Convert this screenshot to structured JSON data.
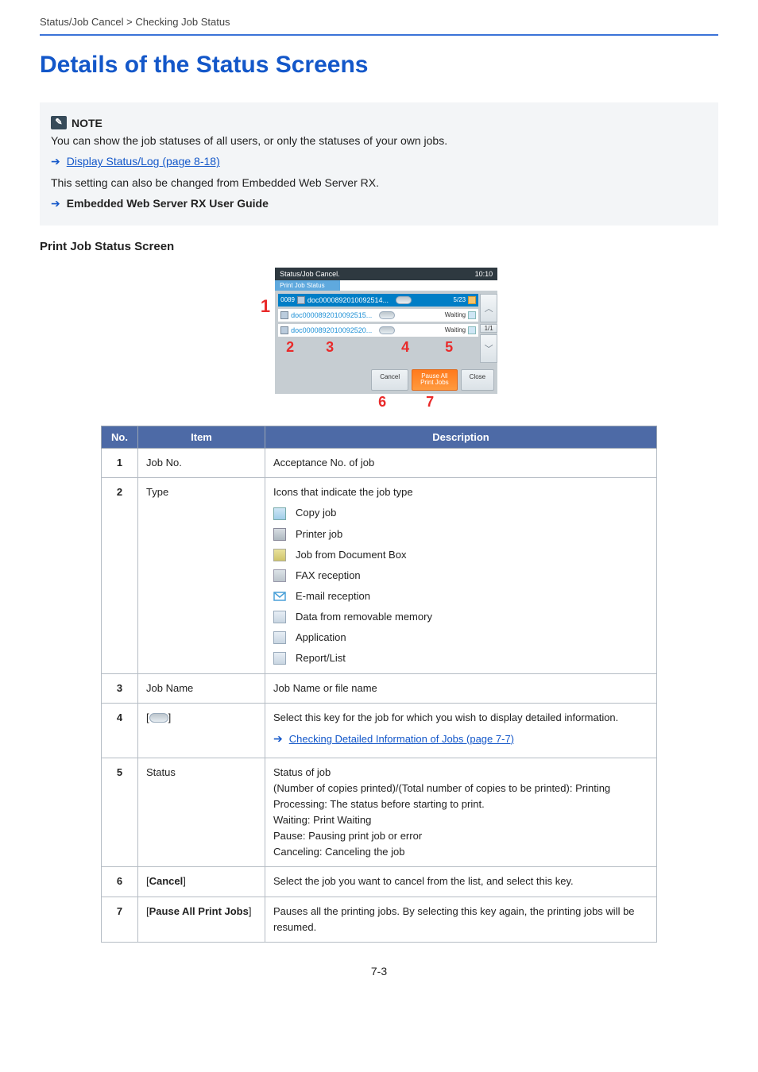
{
  "breadcrumb": "Status/Job Cancel > Checking Job Status",
  "page_title": "Details of the Status Screens",
  "note": {
    "label": "NOTE",
    "line1": "You can show the job statuses of all users, or only the statuses of your own jobs.",
    "link1": "Display Status/Log (page 8-18)",
    "line2": "This setting can also be changed from Embedded Web Server RX.",
    "link2": "Embedded Web Server RX User Guide"
  },
  "section_title": "Print Job Status Screen",
  "panel": {
    "titlebar_left": "Status/Job Cancel.",
    "titlebar_right": "10:10",
    "tab": "Print Job Status",
    "rows": [
      {
        "id": "0089",
        "name": "doc0000892010092514...",
        "status": "5/23"
      },
      {
        "id": "",
        "name": "doc0000892010092515...",
        "status": "Waiting"
      },
      {
        "id": "",
        "name": "doc0000892010092520...",
        "status": "Waiting"
      }
    ],
    "page_indicator": "1/1",
    "footer": {
      "cancel": "Cancel",
      "pause": "Pause All\nPrint Jobs",
      "close": "Close"
    }
  },
  "callouts": [
    "1",
    "2",
    "3",
    "4",
    "5",
    "6",
    "7"
  ],
  "table": {
    "headers": [
      "No.",
      "Item",
      "Description"
    ],
    "rows": [
      {
        "no": "1",
        "item": "Job No.",
        "desc": "Acceptance No. of job"
      },
      {
        "no": "2",
        "item": "Type",
        "desc_intro": "Icons that indicate the job type",
        "icons": [
          "Copy job",
          "Printer job",
          "Job from Document Box",
          "FAX reception",
          "E-mail reception",
          "Data from removable memory",
          "Application",
          "Report/List"
        ]
      },
      {
        "no": "3",
        "item": "Job Name",
        "desc": "Job Name or file name"
      },
      {
        "no": "4",
        "item_prefix": "[",
        "item_suffix": "]",
        "desc": "Select this key for the job for which you wish to display detailed information.",
        "link": "Checking Detailed Information of Jobs (page 7-7)"
      },
      {
        "no": "5",
        "item": "Status",
        "lines": [
          "Status of job",
          "(Number of copies printed)/(Total number of copies to be printed): Printing",
          "Processing: The status before starting to print.",
          "Waiting: Print Waiting",
          "Pause: Pausing print job or error",
          "Canceling: Canceling the job"
        ]
      },
      {
        "no": "6",
        "item": "[Cancel]",
        "desc": "Select the job you want to cancel from the list, and select this key."
      },
      {
        "no": "7",
        "item": "[Pause All Print Jobs]",
        "desc": "Pauses all the printing jobs. By selecting this key again, the printing jobs will be resumed."
      }
    ]
  },
  "page_number": "7-3"
}
